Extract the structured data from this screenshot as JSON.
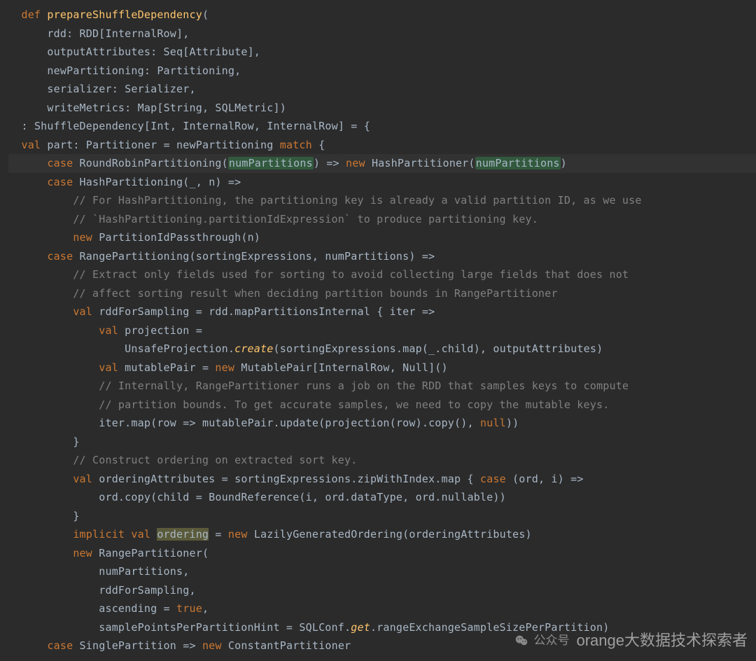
{
  "watermark": {
    "label": "公众号",
    "brand": "orange大数据技术探索者"
  },
  "code": {
    "tokens": [
      [
        [
          "kw",
          "def "
        ],
        [
          "fn",
          "prepareShuffleDependency"
        ],
        [
          "br",
          "("
        ]
      ],
      [
        [
          "id",
          "    rdd: RDD"
        ],
        [
          "br",
          "["
        ],
        [
          "id",
          "InternalRow"
        ],
        [
          "br",
          "],"
        ]
      ],
      [
        [
          "id",
          "    outputAttributes: Seq"
        ],
        [
          "br",
          "["
        ],
        [
          "id",
          "Attribute"
        ],
        [
          "br",
          "],"
        ]
      ],
      [
        [
          "id",
          "    newPartitioning: Partitioning"
        ],
        [
          "br",
          ","
        ]
      ],
      [
        [
          "id",
          "    serializer: Serializer"
        ],
        [
          "br",
          ","
        ]
      ],
      [
        [
          "id",
          "    writeMetrics: Map"
        ],
        [
          "br",
          "["
        ],
        [
          "id",
          "String"
        ],
        [
          "br",
          ", "
        ],
        [
          "id",
          "SQLMetric"
        ],
        [
          "br",
          "])"
        ]
      ],
      [
        [
          "br",
          ": "
        ],
        [
          "id",
          "ShuffleDependency"
        ],
        [
          "br",
          "["
        ],
        [
          "id",
          "Int"
        ],
        [
          "br",
          ", "
        ],
        [
          "id",
          "InternalRow"
        ],
        [
          "br",
          ", "
        ],
        [
          "id",
          "InternalRow"
        ],
        [
          "br",
          "] = {"
        ]
      ],
      [
        [
          "kw",
          "val "
        ],
        [
          "id",
          "part: Partitioner = newPartitioning "
        ],
        [
          "kw",
          "match"
        ],
        [
          "br",
          " {"
        ]
      ],
      "HL_LINE_START",
      [
        [
          "sp",
          "  "
        ],
        [
          "kw",
          "case "
        ],
        [
          "id",
          "RoundRobinPartitioning"
        ],
        [
          "br",
          "("
        ],
        [
          "param-hl",
          "numPartitions"
        ],
        [
          "br",
          ") => "
        ],
        [
          "kw",
          "new "
        ],
        [
          "id",
          "HashPartitioner"
        ],
        [
          "br",
          "("
        ],
        [
          "param-hl",
          "numPartitions"
        ],
        [
          "br",
          ")"
        ]
      ],
      "HL_LINE_END",
      [
        [
          "sp",
          "  "
        ],
        [
          "kw",
          "case "
        ],
        [
          "id",
          "HashPartitioning"
        ],
        [
          "br",
          "("
        ],
        [
          "id",
          "_"
        ],
        [
          "br",
          ", "
        ],
        [
          "id",
          "n"
        ],
        [
          "br",
          ") =>"
        ]
      ],
      [
        [
          "sp",
          "    "
        ],
        [
          "cmt",
          "// For HashPartitioning, the partitioning key is already a valid partition ID, as we use"
        ]
      ],
      [
        [
          "sp",
          "    "
        ],
        [
          "cmt",
          "// `HashPartitioning.partitionIdExpression` to produce partitioning key."
        ]
      ],
      [
        [
          "sp",
          "    "
        ],
        [
          "kw",
          "new "
        ],
        [
          "id",
          "PartitionIdPassthrough"
        ],
        [
          "br",
          "("
        ],
        [
          "id",
          "n"
        ],
        [
          "br",
          ")"
        ]
      ],
      [
        [
          "sp",
          "  "
        ],
        [
          "kw",
          "case "
        ],
        [
          "id",
          "RangePartitioning"
        ],
        [
          "br",
          "("
        ],
        [
          "id",
          "sortingExpressions"
        ],
        [
          "br",
          ", "
        ],
        [
          "id",
          "numPartitions"
        ],
        [
          "br",
          ") =>"
        ]
      ],
      [
        [
          "sp",
          "    "
        ],
        [
          "cmt",
          "// Extract only fields used for sorting to avoid collecting large fields that does not"
        ]
      ],
      [
        [
          "sp",
          "    "
        ],
        [
          "cmt",
          "// affect sorting result when deciding partition bounds in RangePartitioner"
        ]
      ],
      [
        [
          "sp",
          "    "
        ],
        [
          "kw",
          "val "
        ],
        [
          "id",
          "rddForSampling = rdd.mapPartitionsInternal "
        ],
        [
          "br",
          "{"
        ],
        [
          "id",
          " iter "
        ],
        [
          "br",
          "=>"
        ]
      ],
      [
        [
          "sp",
          "      "
        ],
        [
          "kw",
          "val "
        ],
        [
          "id",
          "projection ="
        ]
      ],
      [
        [
          "sp",
          "        "
        ],
        [
          "id",
          "UnsafeProjection."
        ],
        [
          "it",
          "create"
        ],
        [
          "br",
          "("
        ],
        [
          "id",
          "sortingExpressions.map"
        ],
        [
          "br",
          "("
        ],
        [
          "id",
          "_.child"
        ],
        [
          "br",
          "), "
        ],
        [
          "id",
          "outputAttributes"
        ],
        [
          "br",
          ")"
        ]
      ],
      [
        [
          "sp",
          "      "
        ],
        [
          "kw",
          "val "
        ],
        [
          "id",
          "mutablePair = "
        ],
        [
          "kw",
          "new "
        ],
        [
          "id",
          "MutablePair"
        ],
        [
          "br",
          "["
        ],
        [
          "id",
          "InternalRow"
        ],
        [
          "br",
          ", "
        ],
        [
          "id",
          "Null"
        ],
        [
          "br",
          "]()"
        ]
      ],
      [
        [
          "sp",
          "      "
        ],
        [
          "cmt",
          "// Internally, RangePartitioner runs a job on the RDD that samples keys to compute"
        ]
      ],
      [
        [
          "sp",
          "      "
        ],
        [
          "cmt",
          "// partition bounds. To get accurate samples, we need to copy the mutable keys."
        ]
      ],
      [
        [
          "sp",
          "      "
        ],
        [
          "id",
          "iter.map"
        ],
        [
          "br",
          "("
        ],
        [
          "id",
          "row "
        ],
        [
          "br",
          "=> "
        ],
        [
          "id",
          "mutablePair.update"
        ],
        [
          "br",
          "("
        ],
        [
          "id",
          "projection"
        ],
        [
          "br",
          "("
        ],
        [
          "id",
          "row"
        ],
        [
          "br",
          ")."
        ],
        [
          "id",
          "copy"
        ],
        [
          "br",
          "(), "
        ],
        [
          "kw",
          "null"
        ],
        [
          "br",
          "))"
        ]
      ],
      [
        [
          "sp",
          "    "
        ],
        [
          "br",
          "}"
        ]
      ],
      [
        [
          "sp",
          "    "
        ],
        [
          "cmt",
          "// Construct ordering on extracted sort key."
        ]
      ],
      [
        [
          "sp",
          "    "
        ],
        [
          "kw",
          "val "
        ],
        [
          "id",
          "orderingAttributes = sortingExpressions.zipWithIndex.map "
        ],
        [
          "br",
          "{"
        ],
        [
          "id",
          " "
        ],
        [
          "kw",
          "case "
        ],
        [
          "br",
          "("
        ],
        [
          "id",
          "ord"
        ],
        [
          "br",
          ", "
        ],
        [
          "id",
          "i"
        ],
        [
          "br",
          ") =>"
        ]
      ],
      [
        [
          "sp",
          "      "
        ],
        [
          "id",
          "ord.copy"
        ],
        [
          "br",
          "("
        ],
        [
          "id",
          "child = BoundReference"
        ],
        [
          "br",
          "("
        ],
        [
          "id",
          "i"
        ],
        [
          "br",
          ", "
        ],
        [
          "id",
          "ord.dataType"
        ],
        [
          "br",
          ", "
        ],
        [
          "id",
          "ord.nullable"
        ],
        [
          "br",
          "))"
        ]
      ],
      [
        [
          "sp",
          "    "
        ],
        [
          "br",
          "}"
        ]
      ],
      [
        [
          "sp",
          "    "
        ],
        [
          "kw",
          "implicit val "
        ],
        [
          "sel",
          "ordering"
        ],
        [
          "id",
          " = "
        ],
        [
          "kw",
          "new "
        ],
        [
          "id",
          "LazilyGeneratedOrdering"
        ],
        [
          "br",
          "("
        ],
        [
          "id",
          "orderingAttributes"
        ],
        [
          "br",
          ")"
        ]
      ],
      [
        [
          "sp",
          "    "
        ],
        [
          "kw",
          "new "
        ],
        [
          "id",
          "RangePartitioner"
        ],
        [
          "br",
          "("
        ]
      ],
      [
        [
          "sp",
          "      "
        ],
        [
          "id",
          "numPartitions"
        ],
        [
          "br",
          ","
        ]
      ],
      [
        [
          "sp",
          "      "
        ],
        [
          "id",
          "rddForSampling"
        ],
        [
          "br",
          ","
        ]
      ],
      [
        [
          "sp",
          "      "
        ],
        [
          "id",
          "ascending = "
        ],
        [
          "kw",
          "true"
        ],
        [
          "br",
          ","
        ]
      ],
      [
        [
          "sp",
          "      "
        ],
        [
          "id",
          "samplePointsPerPartitionHint = SQLConf."
        ],
        [
          "it",
          "get"
        ],
        [
          "id",
          ".rangeExchangeSampleSizePerPartition"
        ],
        [
          "br",
          ")"
        ]
      ],
      [
        [
          "sp",
          "  "
        ],
        [
          "kw",
          "case "
        ],
        [
          "id",
          "SinglePartition "
        ],
        [
          "br",
          "=> "
        ],
        [
          "kw",
          "new "
        ],
        [
          "id",
          "ConstantPartitioner"
        ]
      ]
    ],
    "indentBase": "  "
  }
}
